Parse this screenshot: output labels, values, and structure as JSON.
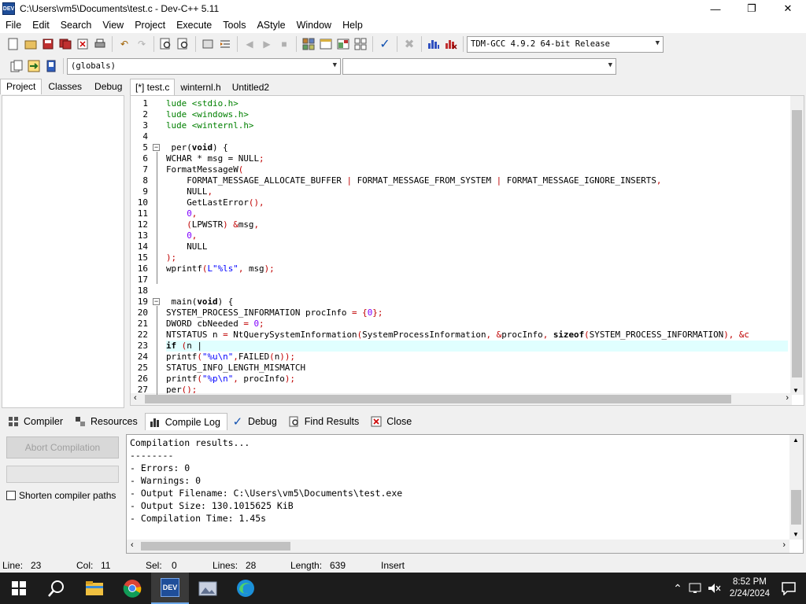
{
  "window": {
    "title": "C:\\Users\\vm5\\Documents\\test.c - Dev-C++ 5.11",
    "icon_label": "DEV"
  },
  "menu": [
    "File",
    "Edit",
    "Search",
    "View",
    "Project",
    "Execute",
    "Tools",
    "AStyle",
    "Window",
    "Help"
  ],
  "toolbar": {
    "compiler": "TDM-GCC 4.9.2 64-bit Release",
    "scope": "(globals)",
    "members": ""
  },
  "left_tabs": [
    "Project",
    "Classes",
    "Debug"
  ],
  "editor_tabs": [
    "[*] test.c",
    "winternl.h",
    "Untitled2"
  ],
  "code_lines": [
    {
      "n": "1",
      "segs": [
        {
          "t": "lude <stdio.h>",
          "c": "#008000"
        }
      ]
    },
    {
      "n": "2",
      "segs": [
        {
          "t": "lude <windows.h>",
          "c": "#008000"
        }
      ]
    },
    {
      "n": "3",
      "segs": [
        {
          "t": "lude <winternl.h>",
          "c": "#008000"
        }
      ]
    },
    {
      "n": "4",
      "segs": []
    },
    {
      "n": "5",
      "fold": true,
      "segs": [
        {
          "t": " per(",
          "c": "#000"
        },
        {
          "t": "void",
          "c": "#000",
          "b": true
        },
        {
          "t": ") {",
          "c": "#000"
        }
      ]
    },
    {
      "n": "6",
      "segs": [
        {
          "t": "WCHAR * msg = NULL",
          "c": "#000"
        },
        {
          "t": ";",
          "c": "#c00000"
        }
      ]
    },
    {
      "n": "7",
      "segs": [
        {
          "t": "FormatMessageW",
          "c": "#000"
        },
        {
          "t": "(",
          "c": "#c00000"
        }
      ]
    },
    {
      "n": "8",
      "segs": [
        {
          "t": "    FORMAT_MESSAGE_ALLOCATE_BUFFER ",
          "c": "#000"
        },
        {
          "t": "|",
          "c": "#c00000"
        },
        {
          "t": " FORMAT_MESSAGE_FROM_SYSTEM ",
          "c": "#000"
        },
        {
          "t": "|",
          "c": "#c00000"
        },
        {
          "t": " FORMAT_MESSAGE_IGNORE_INSERTS",
          "c": "#000"
        },
        {
          "t": ",",
          "c": "#c00000"
        }
      ]
    },
    {
      "n": "9",
      "segs": [
        {
          "t": "    NULL",
          "c": "#000"
        },
        {
          "t": ",",
          "c": "#c00000"
        }
      ]
    },
    {
      "n": "10",
      "segs": [
        {
          "t": "    GetLastError",
          "c": "#000"
        },
        {
          "t": "(),",
          "c": "#c00000"
        }
      ]
    },
    {
      "n": "11",
      "segs": [
        {
          "t": "    ",
          "c": "#000"
        },
        {
          "t": "0",
          "c": "#8000ff"
        },
        {
          "t": ",",
          "c": "#c00000"
        }
      ]
    },
    {
      "n": "12",
      "segs": [
        {
          "t": "    ",
          "c": "#000"
        },
        {
          "t": "(",
          "c": "#c00000"
        },
        {
          "t": "LPWSTR",
          "c": "#000"
        },
        {
          "t": ") &",
          "c": "#c00000"
        },
        {
          "t": "msg",
          "c": "#000"
        },
        {
          "t": ",",
          "c": "#c00000"
        }
      ]
    },
    {
      "n": "13",
      "segs": [
        {
          "t": "    ",
          "c": "#000"
        },
        {
          "t": "0",
          "c": "#8000ff"
        },
        {
          "t": ",",
          "c": "#c00000"
        }
      ]
    },
    {
      "n": "14",
      "segs": [
        {
          "t": "    NULL",
          "c": "#000"
        }
      ]
    },
    {
      "n": "15",
      "segs": [
        {
          "t": ");",
          "c": "#c00000"
        }
      ]
    },
    {
      "n": "16",
      "segs": [
        {
          "t": "wprintf",
          "c": "#000"
        },
        {
          "t": "(",
          "c": "#c00000"
        },
        {
          "t": "L\"%ls\"",
          "c": "#0000ff"
        },
        {
          "t": ", ",
          "c": "#c00000"
        },
        {
          "t": "msg",
          "c": "#000"
        },
        {
          "t": ");",
          "c": "#c00000"
        }
      ]
    },
    {
      "n": "17",
      "segs": []
    },
    {
      "n": "18",
      "segs": []
    },
    {
      "n": "19",
      "fold": true,
      "segs": [
        {
          "t": " main(",
          "c": "#000"
        },
        {
          "t": "void",
          "c": "#000",
          "b": true
        },
        {
          "t": ") {",
          "c": "#000"
        }
      ]
    },
    {
      "n": "20",
      "segs": [
        {
          "t": "SYSTEM_PROCESS_INFORMATION procInfo ",
          "c": "#000"
        },
        {
          "t": "= {",
          "c": "#c00000"
        },
        {
          "t": "0",
          "c": "#8000ff"
        },
        {
          "t": "};",
          "c": "#c00000"
        }
      ]
    },
    {
      "n": "21",
      "segs": [
        {
          "t": "DWORD cbNeeded ",
          "c": "#000"
        },
        {
          "t": "=",
          "c": "#c00000"
        },
        {
          "t": " ",
          "c": "#000"
        },
        {
          "t": "0",
          "c": "#8000ff"
        },
        {
          "t": ";",
          "c": "#c00000"
        }
      ]
    },
    {
      "n": "22",
      "segs": [
        {
          "t": "NTSTATUS n ",
          "c": "#000"
        },
        {
          "t": "=",
          "c": "#c00000"
        },
        {
          "t": " NtQuerySystemInformation",
          "c": "#000"
        },
        {
          "t": "(",
          "c": "#c00000"
        },
        {
          "t": "SystemProcessInformation",
          "c": "#000"
        },
        {
          "t": ", &",
          "c": "#c00000"
        },
        {
          "t": "procInfo",
          "c": "#000"
        },
        {
          "t": ", ",
          "c": "#c00000"
        },
        {
          "t": "sizeof",
          "c": "#000",
          "b": true
        },
        {
          "t": "(",
          "c": "#c00000"
        },
        {
          "t": "SYSTEM_PROCESS_INFORMATION",
          "c": "#000"
        },
        {
          "t": "), &c",
          "c": "#c00000"
        }
      ]
    },
    {
      "n": "23",
      "hl": true,
      "segs": [
        {
          "t": "if",
          "c": "#000",
          "b": true
        },
        {
          "t": " (",
          "c": "#c00000"
        },
        {
          "t": "n |",
          "c": "#000"
        }
      ]
    },
    {
      "n": "24",
      "segs": [
        {
          "t": "printf",
          "c": "#000"
        },
        {
          "t": "(",
          "c": "#c00000"
        },
        {
          "t": "\"%u\\n\"",
          "c": "#0000ff"
        },
        {
          "t": ",",
          "c": "#c00000"
        },
        {
          "t": "FAILED",
          "c": "#000"
        },
        {
          "t": "(",
          "c": "#c00000"
        },
        {
          "t": "n",
          "c": "#000"
        },
        {
          "t": "));",
          "c": "#c00000"
        }
      ]
    },
    {
      "n": "25",
      "segs": [
        {
          "t": "STATUS_INFO_LENGTH_MISMATCH",
          "c": "#000"
        }
      ]
    },
    {
      "n": "26",
      "segs": [
        {
          "t": "printf",
          "c": "#000"
        },
        {
          "t": "(",
          "c": "#c00000"
        },
        {
          "t": "\"%p\\n\"",
          "c": "#0000ff"
        },
        {
          "t": ", ",
          "c": "#c00000"
        },
        {
          "t": "procInfo",
          "c": "#000"
        },
        {
          "t": ");",
          "c": "#c00000"
        }
      ]
    },
    {
      "n": "27",
      "segs": [
        {
          "t": "per",
          "c": "#000"
        },
        {
          "t": "();",
          "c": "#c00000"
        }
      ]
    }
  ],
  "bottom_tabs": [
    {
      "label": "Compiler",
      "icon": "compiler-icon"
    },
    {
      "label": "Resources",
      "icon": "resources-icon"
    },
    {
      "label": "Compile Log",
      "icon": "chart-icon"
    },
    {
      "label": "Debug",
      "icon": "check-icon"
    },
    {
      "label": "Find Results",
      "icon": "find-icon"
    },
    {
      "label": "Close",
      "icon": "close-icon"
    }
  ],
  "compile": {
    "abort_label": "Abort Compilation",
    "shorten_label": "Shorten compiler paths",
    "log": [
      "Compilation results...",
      "--------",
      "- Errors: 0",
      "- Warnings: 0",
      "- Output Filename: C:\\Users\\vm5\\Documents\\test.exe",
      "- Output Size: 130.1015625 KiB",
      "- Compilation Time: 1.45s"
    ]
  },
  "status": {
    "line_label": "Line:",
    "line": "23",
    "col_label": "Col:",
    "col": "11",
    "sel_label": "Sel:",
    "sel": "0",
    "lines_label": "Lines:",
    "lines": "28",
    "length_label": "Length:",
    "length": "639",
    "mode": "Insert"
  },
  "taskbar": {
    "time": "8:52 PM",
    "date": "2/24/2024"
  }
}
